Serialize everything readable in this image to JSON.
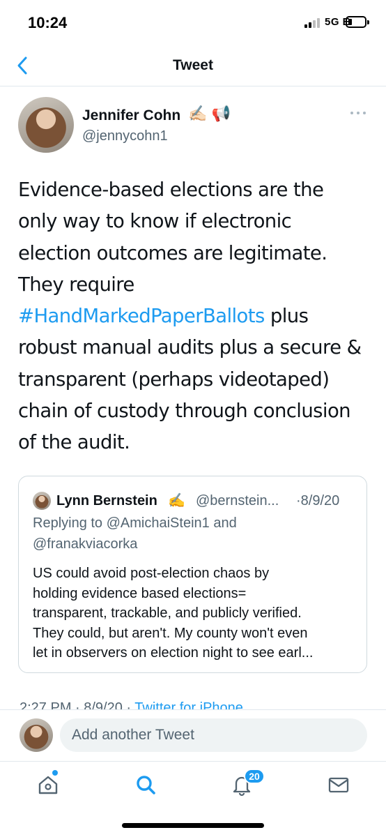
{
  "status_bar": {
    "time": "10:24",
    "network": "5G E"
  },
  "nav": {
    "title": "Tweet"
  },
  "tweet": {
    "author_name": "Jennifer Cohn",
    "author_emoji": "✍🏻 📢",
    "author_handle": "@jennycohn1",
    "text_lines": [
      "Evidence-based elections are the",
      "only way to know if electronic",
      "election outcomes are legitimate.",
      "They require",
      "plus",
      "robust manual audits plus a secure &",
      "transparent (perhaps videotaped)",
      "chain of custody through conclusion",
      "of the audit."
    ],
    "hashtag": "#HandMarkedPaperBallots",
    "meta_time": "2:27 PM · 8/9/20 · ",
    "meta_client": "Twitter for iPhone"
  },
  "quoted_tweet": {
    "author_name": "Lynn Bernstein",
    "author_emoji": "✍️",
    "author_handle": "@bernstein...",
    "date": "·8/9/20",
    "reply_lines": [
      "Replying to @AmichaiStein1 and",
      "@franakviacorka"
    ],
    "text_lines": [
      "US could avoid post-election chaos by",
      "holding evidence based elections=",
      "transparent, trackable, and publicly verified.",
      "They could, but aren't. My county won't even",
      "let in observers on election night to see earl..."
    ]
  },
  "composer": {
    "placeholder": "Add another Tweet"
  },
  "tabbar": {
    "notification_count": "20"
  },
  "colors": {
    "accent": "#1d9bf0",
    "secondary_text": "#536471",
    "border": "#cfd9de"
  },
  "icons": [
    "chevron-left-icon",
    "more-icon",
    "home-icon",
    "search-icon",
    "bell-icon",
    "mail-icon"
  ]
}
